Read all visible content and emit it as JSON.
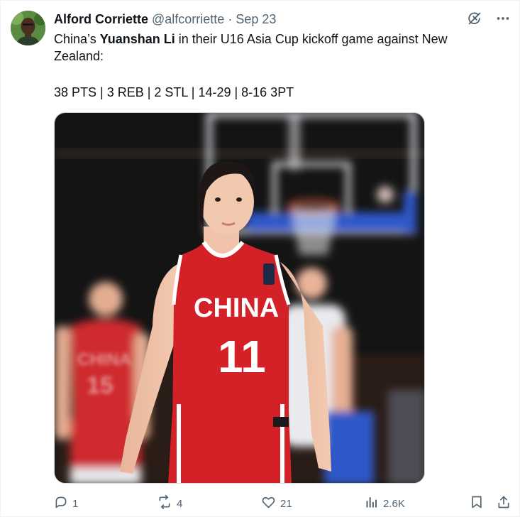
{
  "author": {
    "display_name": "Alford Corriette",
    "handle": "@alfcorriette",
    "separator": "·",
    "date": "Sep 23"
  },
  "tweet": {
    "text_prefix": "China’s ",
    "text_bold": "Yuanshan Li",
    "text_suffix": " in their U16 Asia Cup kickoff game against New Zealand:",
    "stat_line": "38 PTS | 3 REB | 2 STL | 14-29 | 8-16 3PT"
  },
  "media": {
    "jersey_team": "CHINA",
    "jersey_number": "11",
    "blurred_jersey_team": "CHINA",
    "blurred_jersey_number": "15",
    "colors": {
      "jersey": "#d42128",
      "background": "#141414",
      "backboard": "#2f59c9"
    }
  },
  "actions": {
    "replies": "1",
    "reposts": "4",
    "likes": "21",
    "views": "2.6K"
  },
  "icons": [
    "grok-icon",
    "more-icon",
    "reply-icon",
    "repost-icon",
    "like-icon",
    "views-icon",
    "bookmark-icon",
    "share-icon"
  ]
}
